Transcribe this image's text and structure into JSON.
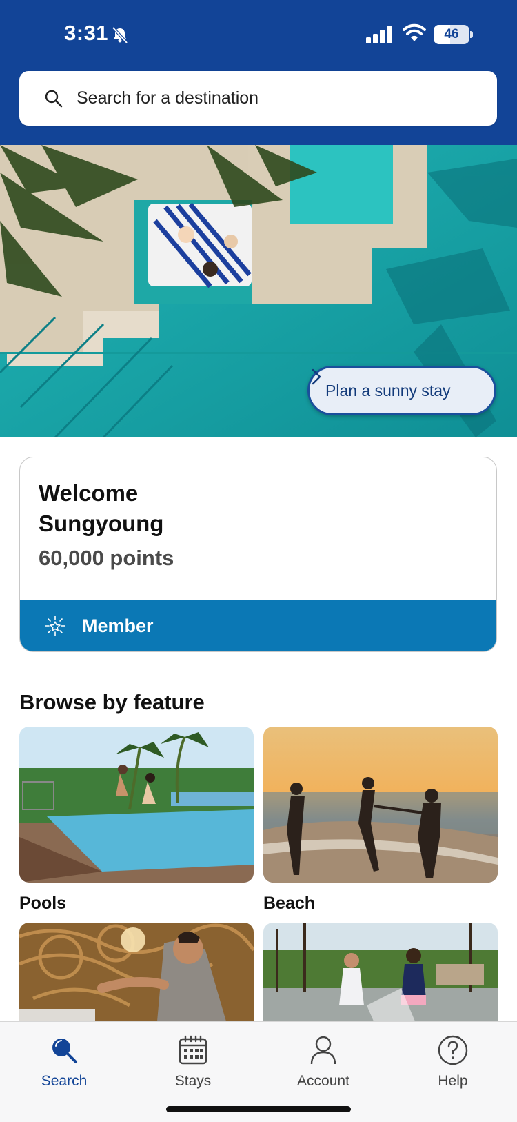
{
  "status_bar": {
    "time": "3:31",
    "battery_level": "46",
    "battery_fraction": 0.46,
    "icons": [
      "bell-muted-icon",
      "signal-icon",
      "wifi-icon",
      "battery-icon"
    ]
  },
  "search": {
    "placeholder": "Search for a destination",
    "icon": "search-icon"
  },
  "hero": {
    "cta_label": "Plan a sunny stay",
    "cta_icon": "chevron-right-icon"
  },
  "welcome": {
    "greeting_line1": "Welcome",
    "greeting_line2": "Sungyoung",
    "points": "60,000 points",
    "tier_label": "Member",
    "tier_icon": "star-burst-icon"
  },
  "browse": {
    "title": "Browse by feature",
    "features": [
      {
        "label": "Pools"
      },
      {
        "label": "Beach"
      },
      {
        "label": ""
      },
      {
        "label": ""
      }
    ]
  },
  "tabs": [
    {
      "label": "Search",
      "icon": "search-icon",
      "active": true
    },
    {
      "label": "Stays",
      "icon": "calendar-icon",
      "active": false
    },
    {
      "label": "Account",
      "icon": "person-icon",
      "active": false
    },
    {
      "label": "Help",
      "icon": "question-circle-icon",
      "active": false
    }
  ],
  "colors": {
    "header_blue": "#124497",
    "tier_blue": "#0b78b5",
    "active_tab": "#124497",
    "pool_teal": "#1aa7a4"
  }
}
